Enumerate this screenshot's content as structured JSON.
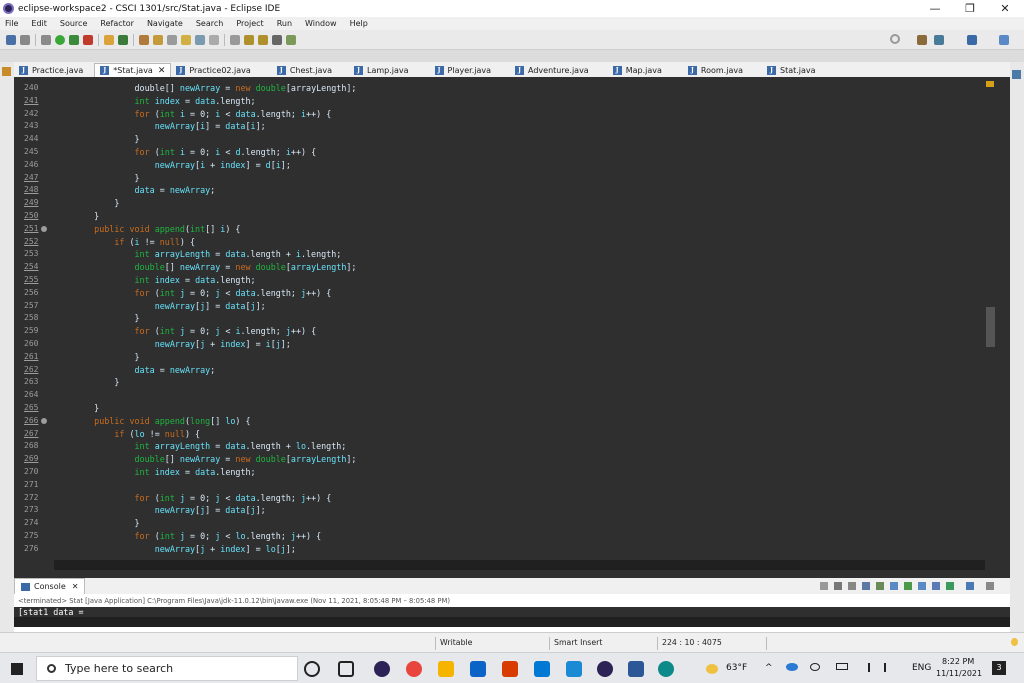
{
  "window": {
    "title": "eclipse-workspace2 - CSCI 1301/src/Stat.java - Eclipse IDE",
    "minimize": "—",
    "maximize": "❐",
    "close": "✕"
  },
  "menu": [
    "File",
    "Edit",
    "Source",
    "Refactor",
    "Navigate",
    "Search",
    "Project",
    "Run",
    "Window",
    "Help"
  ],
  "tabs": [
    {
      "label": "Practice.java"
    },
    {
      "label": "*Stat.java",
      "active": true
    },
    {
      "label": "Practice02.java"
    },
    {
      "label": "Chest.java"
    },
    {
      "label": "Lamp.java"
    },
    {
      "label": "Player.java"
    },
    {
      "label": "Adventure.java"
    },
    {
      "label": "Map.java"
    },
    {
      "label": "Room.java"
    },
    {
      "label": "Stat.java"
    }
  ],
  "editor": {
    "lines": [
      {
        "n": "240",
        "u": false,
        "html": "            <span class=\"ovr\">double</span>[] <span class=\"vr\">newArray</span> = <span class=\"kw\">new</span> <span class=\"ty\">double</span>[<span class=\"ovr\">arrayLength</span>];"
      },
      {
        "n": "241",
        "u": true,
        "html": "            <span class=\"ty\">int</span> <span class=\"vr\">index</span> = <span class=\"vr\">data</span>.length;"
      },
      {
        "n": "242",
        "u": false,
        "html": "            <span class=\"kw\">for</span> (<span class=\"ty\">int</span> <span class=\"vr\">i</span> = 0; <span class=\"vr\">i</span> &lt; <span class=\"vr\">data</span>.length; <span class=\"vr\">i</span>++) {"
      },
      {
        "n": "243",
        "u": false,
        "html": "                <span class=\"vr\">newArray</span>[<span class=\"vr\">i</span>] = <span class=\"vr\">data</span>[<span class=\"vr\">i</span>];"
      },
      {
        "n": "244",
        "u": false,
        "html": "            }"
      },
      {
        "n": "245",
        "u": false,
        "html": "            <span class=\"kw\">for</span> (<span class=\"ty\">int</span> <span class=\"vr\">i</span> = 0; <span class=\"vr\">i</span> &lt; <span class=\"vr\">d</span>.length; <span class=\"vr\">i</span>++) {"
      },
      {
        "n": "246",
        "u": false,
        "html": "                <span class=\"vr\">newArray</span>[<span class=\"vr\">i</span> + <span class=\"vr\">index</span>] = <span class=\"vr\">d</span>[<span class=\"vr\">i</span>];"
      },
      {
        "n": "247",
        "u": true,
        "html": "            }"
      },
      {
        "n": "248",
        "u": true,
        "html": "            <span class=\"vr\">data</span> = <span class=\"vr\">newArray</span>;"
      },
      {
        "n": "249",
        "u": true,
        "html": "        }"
      },
      {
        "n": "250",
        "u": true,
        "html": "    }"
      },
      {
        "n": "251",
        "u": true,
        "m": true,
        "html": "    <span class=\"kw\">public</span> <span class=\"kw\">void</span> <span class=\"fn\">append</span>(<span class=\"ty\">int</span>[] <span class=\"vr\">i</span>) {"
      },
      {
        "n": "252",
        "u": true,
        "html": "        <span class=\"kw\">if</span> (<span class=\"vr\">i</span> != <span class=\"kw\">null</span>) {"
      },
      {
        "n": "253",
        "u": false,
        "html": "            <span class=\"ty\">int</span> <span class=\"vr\">arrayLength</span> = <span class=\"vr\">data</span>.length + <span class=\"vr\">i</span>.length;"
      },
      {
        "n": "254",
        "u": true,
        "html": "            <span class=\"ty\">double</span>[] <span class=\"vr\">newArray</span> = <span class=\"kw\">new</span> <span class=\"ty\">double</span>[<span class=\"vr\">arrayLength</span>];"
      },
      {
        "n": "255",
        "u": true,
        "html": "            <span class=\"ty\">int</span> <span class=\"vr\">index</span> = <span class=\"vr\">data</span>.length;"
      },
      {
        "n": "256",
        "u": false,
        "html": "            <span class=\"kw\">for</span> (<span class=\"ty\">int</span> <span class=\"vr\">j</span> = 0; <span class=\"vr\">j</span> &lt; <span class=\"vr\">data</span>.length; <span class=\"vr\">j</span>++) {"
      },
      {
        "n": "257",
        "u": false,
        "html": "                <span class=\"vr\">newArray</span>[<span class=\"vr\">j</span>] = <span class=\"vr\">data</span>[<span class=\"vr\">j</span>];"
      },
      {
        "n": "258",
        "u": false,
        "html": "            }"
      },
      {
        "n": "259",
        "u": false,
        "html": "            <span class=\"kw\">for</span> (<span class=\"ty\">int</span> <span class=\"vr\">j</span> = 0; <span class=\"vr\">j</span> &lt; <span class=\"vr\">i</span>.length; <span class=\"vr\">j</span>++) {"
      },
      {
        "n": "260",
        "u": false,
        "html": "                <span class=\"vr\">newArray</span>[<span class=\"vr\">j</span> + <span class=\"vr\">index</span>] = <span class=\"vr\">i</span>[<span class=\"vr\">j</span>];"
      },
      {
        "n": "261",
        "u": true,
        "html": "            }"
      },
      {
        "n": "262",
        "u": true,
        "html": "            <span class=\"vr\">data</span> = <span class=\"vr\">newArray</span>;"
      },
      {
        "n": "263",
        "u": false,
        "html": "        }"
      },
      {
        "n": "264",
        "u": false,
        "html": ""
      },
      {
        "n": "265",
        "u": true,
        "html": "    }"
      },
      {
        "n": "266",
        "u": true,
        "m": true,
        "html": "    <span class=\"kw\">public</span> <span class=\"kw\">void</span> <span class=\"fn\">append</span>(<span class=\"ty\">long</span>[] <span class=\"vr\">lo</span>) {"
      },
      {
        "n": "267",
        "u": true,
        "html": "        <span class=\"kw\">if</span> (<span class=\"vr\">lo</span> != <span class=\"kw\">null</span>) {"
      },
      {
        "n": "268",
        "u": false,
        "html": "            <span class=\"ty\">int</span> <span class=\"vr\">arrayLength</span> = <span class=\"vr\">data</span>.length + <span class=\"vr\">lo</span>.length;"
      },
      {
        "n": "269",
        "u": true,
        "html": "            <span class=\"ty\">double</span>[] <span class=\"vr\">newArray</span> = <span class=\"kw\">new</span> <span class=\"ty\">double</span>[<span class=\"vr\">arrayLength</span>];"
      },
      {
        "n": "270",
        "u": false,
        "html": "            <span class=\"ty\">int</span> <span class=\"vr\">index</span> = <span class=\"vr\">data</span>.length;"
      },
      {
        "n": "271",
        "u": false,
        "html": ""
      },
      {
        "n": "272",
        "u": false,
        "html": "            <span class=\"kw\">for</span> (<span class=\"ty\">int</span> <span class=\"vr\">j</span> = 0; <span class=\"vr\">j</span> &lt; <span class=\"vr\">data</span>.length; <span class=\"vr\">j</span>++) {"
      },
      {
        "n": "273",
        "u": false,
        "html": "                <span class=\"vr\">newArray</span>[<span class=\"vr\">j</span>] = <span class=\"vr\">data</span>[<span class=\"vr\">j</span>];"
      },
      {
        "n": "274",
        "u": false,
        "html": "            }"
      },
      {
        "n": "275",
        "u": false,
        "html": "            <span class=\"kw\">for</span> (<span class=\"ty\">int</span> <span class=\"vr\">j</span> = 0; <span class=\"vr\">j</span> &lt; <span class=\"vr\">lo</span>.length; <span class=\"vr\">j</span>++) {"
      },
      {
        "n": "276",
        "u": false,
        "html": "                <span class=\"vr\">newArray</span>[<span class=\"vr\">j</span> + <span class=\"vr\">index</span>] = <span class=\"vr\">lo</span>[<span class=\"vr\">j</span>];"
      }
    ]
  },
  "console": {
    "tab_label": "Console",
    "close": "✕",
    "terminated": "<terminated> Stat [Java Application] C:\\Program Files\\Java\\jdk-11.0.12\\bin\\javaw.exe  (Nov 11, 2021, 8:05:48 PM – 8:05:48 PM)",
    "output": "[stat1 data ="
  },
  "status": {
    "writable": "Writable",
    "insert": "Smart Insert",
    "position": "224 : 10 : 4075"
  },
  "taskbar": {
    "search_placeholder": "Type here to search",
    "temp": "63°F",
    "lang": "ENG",
    "time": "8:22 PM",
    "date": "11/11/2021",
    "notif": "3"
  }
}
